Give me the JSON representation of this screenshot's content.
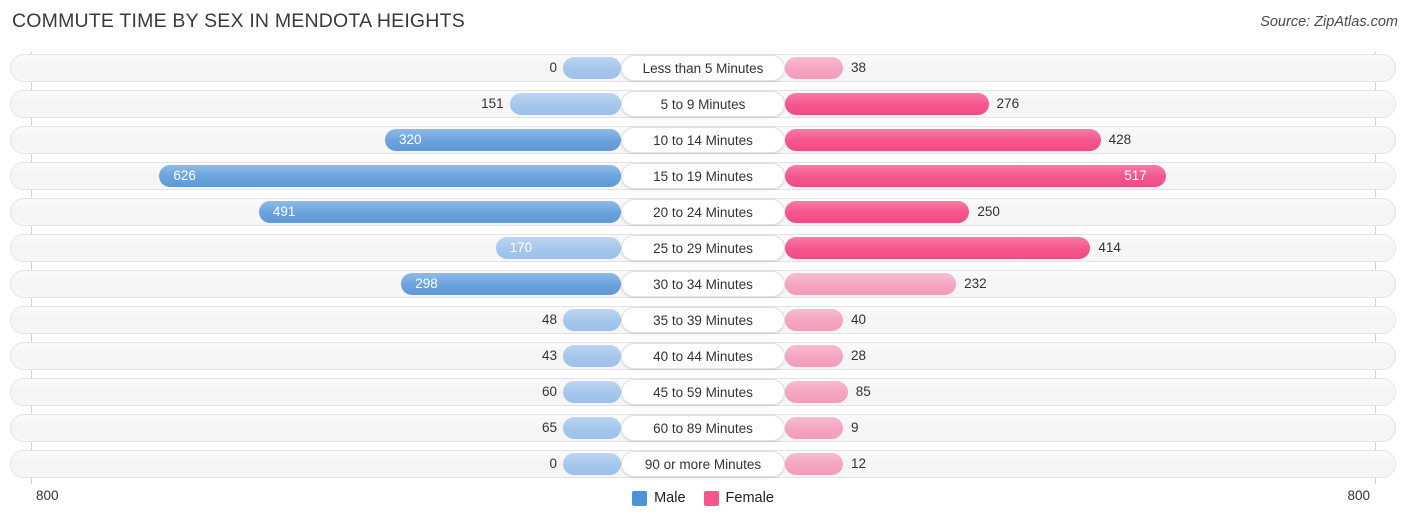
{
  "header": {
    "title": "COMMUTE TIME BY SEX IN MENDOTA HEIGHTS",
    "source": "Source: ZipAtlas.com"
  },
  "axis": {
    "left_max_label": "800",
    "right_max_label": "800"
  },
  "legend": {
    "items": [
      {
        "label": "Male",
        "color": "#4d93d9"
      },
      {
        "label": "Female",
        "color": "#f4568e"
      }
    ]
  },
  "colors": {
    "male_strong": "#5f99d6",
    "male_light": "#a6c7ec",
    "female_strong": "#f4568e",
    "female_light": "#f5a5c2",
    "track": "#f4f4f4",
    "track_border": "#e3e3e3"
  },
  "chart_data": {
    "type": "bar",
    "title": "COMMUTE TIME BY SEX IN MENDOTA HEIGHTS",
    "subtitle": "",
    "xlabel": "",
    "ylabel": "",
    "orientation": "horizontal-diverging",
    "xlim": [
      0,
      800
    ],
    "grid": false,
    "legend_position": "bottom-center",
    "categories": [
      "Less than 5 Minutes",
      "5 to 9 Minutes",
      "10 to 14 Minutes",
      "15 to 19 Minutes",
      "20 to 24 Minutes",
      "25 to 29 Minutes",
      "30 to 34 Minutes",
      "35 to 39 Minutes",
      "40 to 44 Minutes",
      "45 to 59 Minutes",
      "60 to 89 Minutes",
      "90 or more Minutes"
    ],
    "series": [
      {
        "name": "Male",
        "side": "left",
        "values": [
          0,
          151,
          320,
          626,
          491,
          170,
          298,
          48,
          43,
          60,
          65,
          0
        ]
      },
      {
        "name": "Female",
        "side": "right",
        "values": [
          38,
          276,
          428,
          517,
          250,
          414,
          232,
          40,
          28,
          85,
          9,
          12
        ]
      }
    ]
  }
}
